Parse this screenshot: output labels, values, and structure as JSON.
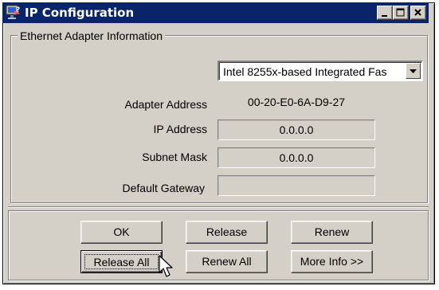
{
  "window": {
    "title": "IP Configuration",
    "buttons": {
      "minimize_icon": "minimize-icon",
      "maximize_icon": "maximize-icon",
      "close_icon": "close-icon"
    }
  },
  "group": {
    "label": "Ethernet  Adapter Information"
  },
  "adapter_select": {
    "value": "Intel 8255x-based Integrated Fas"
  },
  "fields": {
    "adapter_address": {
      "label": "Adapter Address",
      "value": "00-20-E0-6A-D9-27"
    },
    "ip_address": {
      "label": "IP Address",
      "value": "0.0.0.0"
    },
    "subnet_mask": {
      "label": "Subnet Mask",
      "value": "0.0.0.0"
    },
    "default_gateway": {
      "label": "Default Gateway",
      "value": ""
    }
  },
  "buttons": {
    "ok": "OK",
    "release": "Release",
    "renew": "Renew",
    "release_all": "Release All",
    "renew_all": "Renew All",
    "more_info": "More Info >>"
  },
  "colors": {
    "titlebar": "#0a246a",
    "face": "#d4d0c8"
  }
}
